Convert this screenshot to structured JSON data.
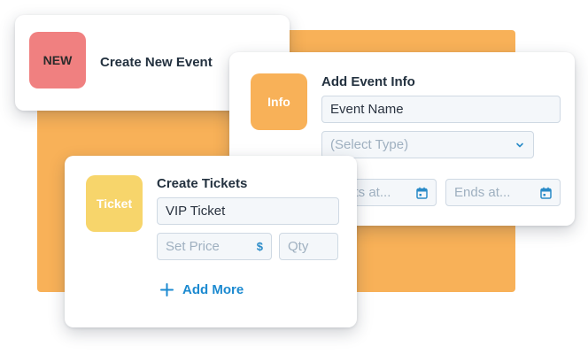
{
  "new_event_card": {
    "badge": "NEW",
    "title": "Create New Event",
    "badge_color": "#f08080"
  },
  "event_info_card": {
    "badge": "Info",
    "title": "Add Event Info",
    "badge_color": "#f8b158",
    "event_name_value": "Event Name",
    "select_type_placeholder": "(Select Type)",
    "starts_placeholder": "Starts at...",
    "ends_placeholder": "Ends at..."
  },
  "tickets_card": {
    "badge": "Ticket",
    "title": "Create Tickets",
    "badge_color": "#f7d56b",
    "ticket_name_value": "VIP Ticket",
    "price_placeholder": "Set Price",
    "price_suffix": "$",
    "qty_placeholder": "Qty",
    "add_more_label": "Add More"
  },
  "colors": {
    "background_accent": "#f8b158",
    "link_blue": "#1c8ad0"
  },
  "icons": [
    "chevron-down-icon",
    "calendar-icon",
    "plus-icon"
  ]
}
